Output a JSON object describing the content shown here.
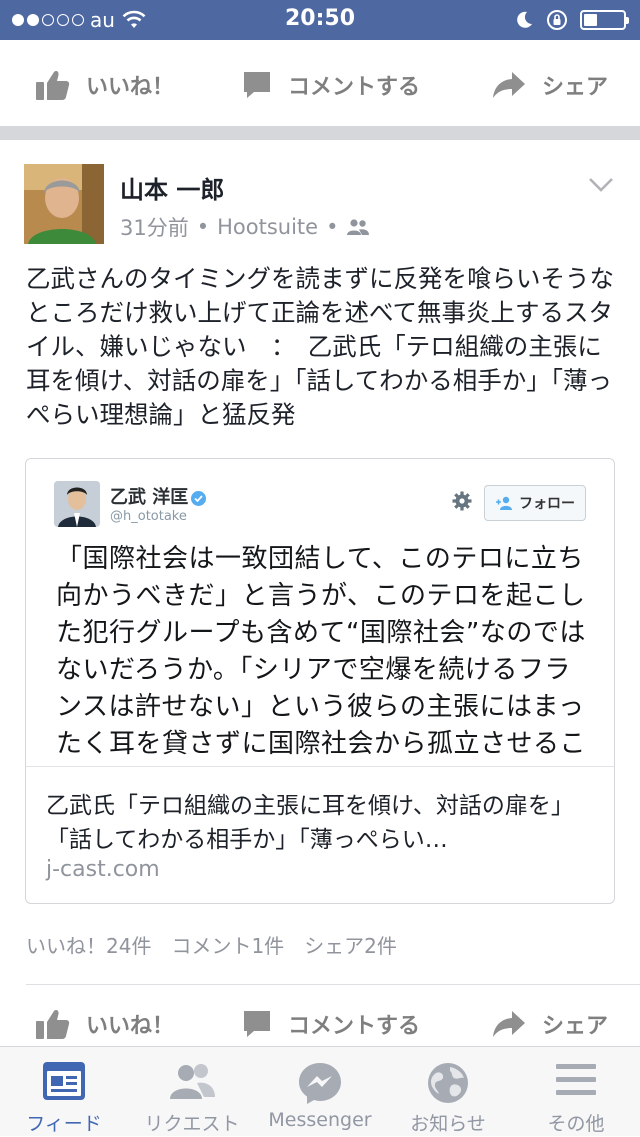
{
  "status_bar": {
    "carrier": "au",
    "time": "20:50",
    "signal_dots": 5,
    "signal_filled": 2,
    "battery_level": 0.35
  },
  "top_actions": {
    "like": "いいね！",
    "comment": "コメントする",
    "share": "シェア"
  },
  "post": {
    "author": "山本 一郎",
    "time": "31分前",
    "via": "Hootsuite",
    "privacy_icon": "friends-icon",
    "text": "乙武さんのタイミングを読まずに反発を喰らいそうなところだけ救い上げて正論を述べて無事炎上するスタイル、嫌いじゃない　：　乙武氏「テロ組織の主張に耳を傾け、対話の扉を」「話してわかる相手か」「薄っぺらい理想論」と猛反発",
    "link": {
      "tweet": {
        "name": "乙武 洋匡",
        "handle": "@h_ototake",
        "follow_label": "フォロー",
        "body": "「国際社会は一致団結して、このテロに立ち向かうべきだ」と言うが、このテロを起こした犯行グループも含めて“国際社会”なのではないだろうか。「シリアで空爆を続けるフランスは許せない」という彼らの主張にはまったく耳を貸さずに国際社会から孤立させることが、本当に平和へと続く道な"
      },
      "title": "乙武氏「テロ組織の主張に耳を傾け、対話の扉を」「話してわかる相手か」「薄っぺらい…",
      "domain": "j-cast.com"
    },
    "counts": {
      "likes": "いいね！24件",
      "comments": "コメント1件",
      "shares": "シェア2件"
    },
    "actions": {
      "like": "いいね！",
      "comment": "コメントする",
      "share": "シェア"
    }
  },
  "tab_bar": [
    {
      "label": "フィード",
      "icon": "feed-icon",
      "active": true
    },
    {
      "label": "リクエスト",
      "icon": "friend-requests-icon",
      "active": false
    },
    {
      "label": "Messenger",
      "icon": "messenger-icon",
      "active": false
    },
    {
      "label": "お知らせ",
      "icon": "globe-notifications-icon",
      "active": false
    },
    {
      "label": "その他",
      "icon": "menu-icon",
      "active": false
    }
  ],
  "colors": {
    "status_bar_bg": "#4e69a2",
    "accent": "#4267b2",
    "text": "#1d2129",
    "muted": "#90949c"
  }
}
